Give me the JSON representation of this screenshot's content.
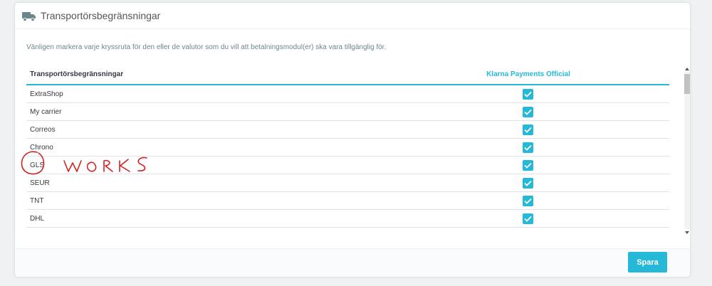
{
  "panel": {
    "title": "Transportörsbegränsningar",
    "icon": "truck-icon",
    "help_text": "Vänligen markera varje kryssruta för den eller de valutor som du vill att betalningsmodul(er) ska vara tillgänglig för."
  },
  "table": {
    "col_carrier": "Transportörsbegränsningar",
    "col_module": "Klarna Payments Official",
    "rows": [
      {
        "name": "ExtraShop",
        "checked": true
      },
      {
        "name": "My carrier",
        "checked": true
      },
      {
        "name": "Correos",
        "checked": true
      },
      {
        "name": "Chrono",
        "checked": true
      },
      {
        "name": "GLS",
        "checked": true
      },
      {
        "name": "SEUR",
        "checked": true
      },
      {
        "name": "TNT",
        "checked": true
      },
      {
        "name": "DHL",
        "checked": true
      }
    ]
  },
  "footer": {
    "save_label": "Spara"
  },
  "annotation": {
    "text": "WORKS",
    "color": "#d42020"
  },
  "colors": {
    "accent": "#25b9d7",
    "background": "#eff1f2"
  }
}
